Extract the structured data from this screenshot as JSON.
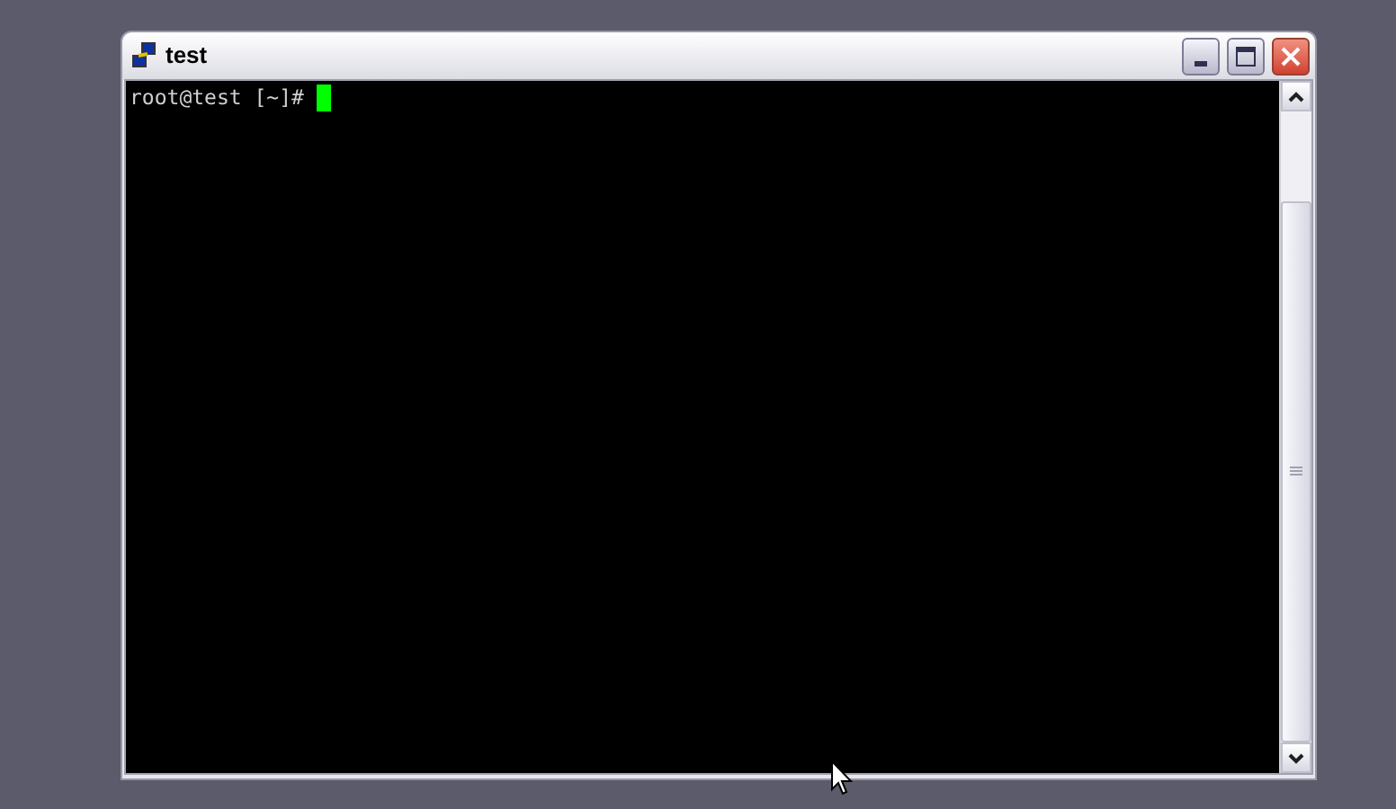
{
  "window": {
    "title": "test"
  },
  "terminal": {
    "lines": [
      "root@test [~]#"
    ]
  }
}
